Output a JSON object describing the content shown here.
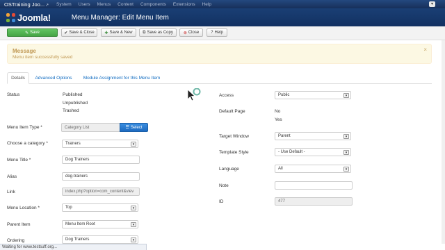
{
  "topbar": {
    "site_name": "OSTraining Joo...",
    "ext_icon": "external-link-icon",
    "menu": [
      "System",
      "Users",
      "Menus",
      "Content",
      "Components",
      "Extensions",
      "Help"
    ],
    "user": "▾"
  },
  "header": {
    "logo": "Joomla!",
    "title": "Menu Manager: Edit Menu Item"
  },
  "toolbar": {
    "save": "Save",
    "save_close": "Save & Close",
    "save_new": "Save & New",
    "save_copy": "Save as Copy",
    "close": "Close",
    "help": "Help"
  },
  "alert": {
    "heading": "Message",
    "message": "Menu item successfully saved",
    "close": "×"
  },
  "tabs": [
    "Details",
    "Advanced Options",
    "Module Assignment for this Menu Item"
  ],
  "left": {
    "status_label": "Status",
    "status_options": [
      "Published",
      "Unpublished",
      "Trashed"
    ],
    "type_label": "Menu Item Type *",
    "type_value": "Category List",
    "select_button": "Select",
    "category_label": "Choose a category *",
    "category_value": "Trainers",
    "title_label": "Menu Title *",
    "title_value": "Dog Trainers",
    "alias_label": "Alias",
    "alias_value": "dog-trainers",
    "link_label": "Link",
    "link_value": "index.php?option=com_content&viev",
    "location_label": "Menu Location *",
    "location_value": "Top",
    "parent_label": "Parent Item",
    "parent_value": "Menu Item Root",
    "ordering_label": "Ordering",
    "ordering_value": "Dog Trainers"
  },
  "right": {
    "access_label": "Access",
    "access_value": "Public",
    "default_label": "Default Page",
    "default_options": [
      "No",
      "Yes"
    ],
    "target_label": "Target Window",
    "target_value": "Parent",
    "template_label": "Template Style",
    "template_value": "- Use Default -",
    "language_label": "Language",
    "language_value": "All",
    "note_label": "Note",
    "note_value": "",
    "id_label": "ID",
    "id_value": "477"
  },
  "statusbar": "Waiting for www.testsuff.org...",
  "colors": {
    "header_bg": "#143566",
    "save_green": "#46a546",
    "select_blue": "#2a7bd2",
    "alert_bg": "#fcf8e3",
    "alert_text": "#c09853",
    "link_blue": "#0e6ac0"
  }
}
